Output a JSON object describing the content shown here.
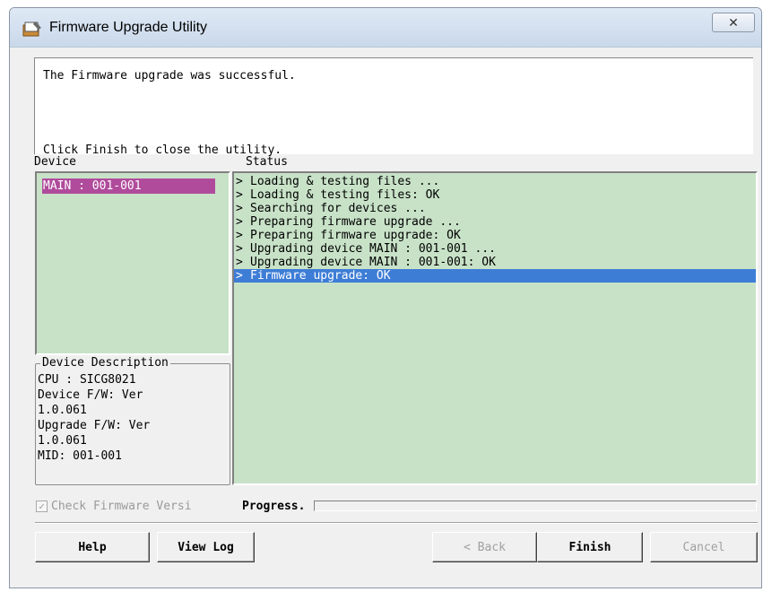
{
  "window": {
    "title": "Firmware Upgrade Utility",
    "close_glyph": "✕"
  },
  "message": {
    "line1": "The Firmware upgrade was successful.",
    "line2": "Click Finish to close the utility."
  },
  "device": {
    "label": "Device",
    "items": [
      "MAIN : 001-001"
    ],
    "selected_color": "#b04b9c"
  },
  "status": {
    "label": "Status",
    "rows": [
      "Loading & testing files ...",
      "Loading & testing files: OK",
      "Searching for devices ...",
      "Preparing firmware upgrade ...",
      "Preparing firmware upgrade: OK",
      "Upgrading device MAIN : 001-001 ...",
      "Upgrading device MAIN : 001-001: OK",
      "Firmware upgrade: OK"
    ],
    "selected_index": 7,
    "selected_color": "#3d7dd6"
  },
  "description": {
    "title": "Device Description",
    "lines": [
      "CPU : SICG8021",
      "Device F/W: Ver",
      "1.0.061",
      "Upgrade F/W: Ver",
      "1.0.061",
      "MID: 001-001"
    ]
  },
  "check_firmware": {
    "label": "Check Firmware Versi",
    "checked": true,
    "enabled": false
  },
  "progress": {
    "label": "Progress.",
    "value_percent": 0
  },
  "buttons": {
    "help": "Help",
    "view_log": "View Log",
    "back": "< Back",
    "finish": "Finish",
    "cancel": "Cancel"
  },
  "colors": {
    "list_bg": "#c8e2c8",
    "titlebar": "#dfe9f5"
  }
}
